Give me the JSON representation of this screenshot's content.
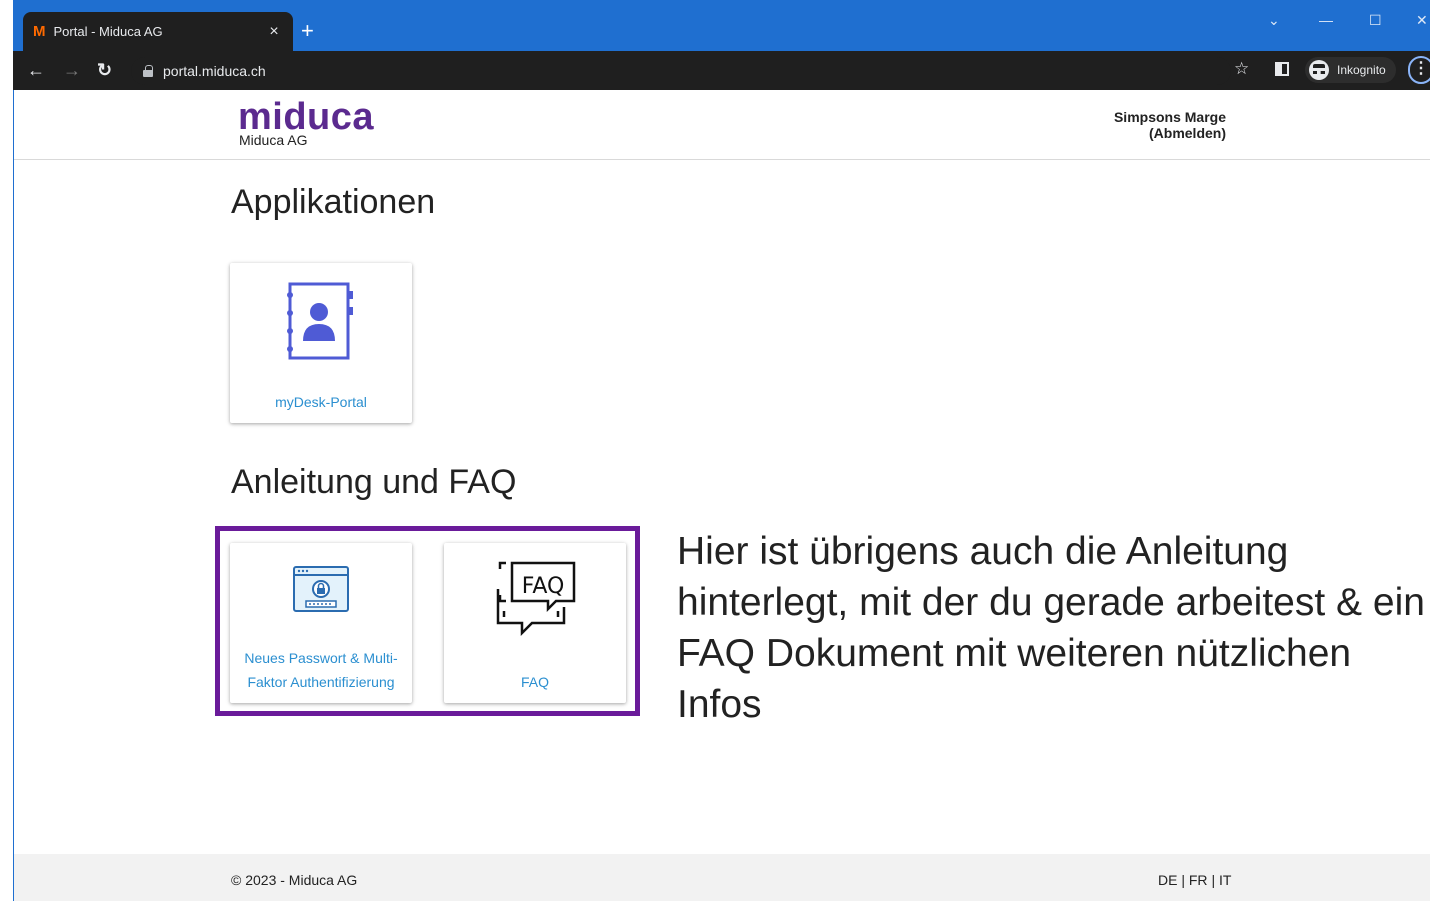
{
  "browser": {
    "tab_title": "Portal - Miduca AG",
    "tab_favicon": "M",
    "tab_close": "×",
    "new_tab": "+",
    "url": "portal.miduca.ch",
    "incognito_label": "Inkognito",
    "icons": {
      "back": "arrow-left-icon",
      "forward": "arrow-right-icon",
      "reload": "reload-icon",
      "lock": "lock-icon",
      "star": "star-icon",
      "menu": "kebab-menu-icon"
    }
  },
  "header": {
    "logo": "miduca",
    "logo_sub": "Miduca AG",
    "user_name": "Simpsons Marge",
    "logout": "(Abmelden)"
  },
  "sections": {
    "apps_title": "Applikationen",
    "faq_title": "Anleitung und FAQ"
  },
  "cards": {
    "mydesk": "myDesk-Portal",
    "password_line1": "Neues Passwort & Multi-",
    "password_line2": "Faktor Authentifizierung",
    "faq": "FAQ",
    "faq_icon_text": "FAQ"
  },
  "callout": "Hier ist übrigens auch die Anleitung hinterlegt, mit der du gerade arbeitest & ein FAQ Dokument mit  weiteren nützlichen Infos",
  "footer": {
    "copyright": "© 2023 - Miduca AG",
    "lang_de": "DE",
    "lang_fr": "FR",
    "lang_it": "IT",
    "separator": "|"
  },
  "colors": {
    "brand_purple": "#5b2a8f",
    "highlight": "#6a1b9a",
    "link_blue": "#2b8fd0",
    "icon_indigo": "#4f5bd5"
  }
}
